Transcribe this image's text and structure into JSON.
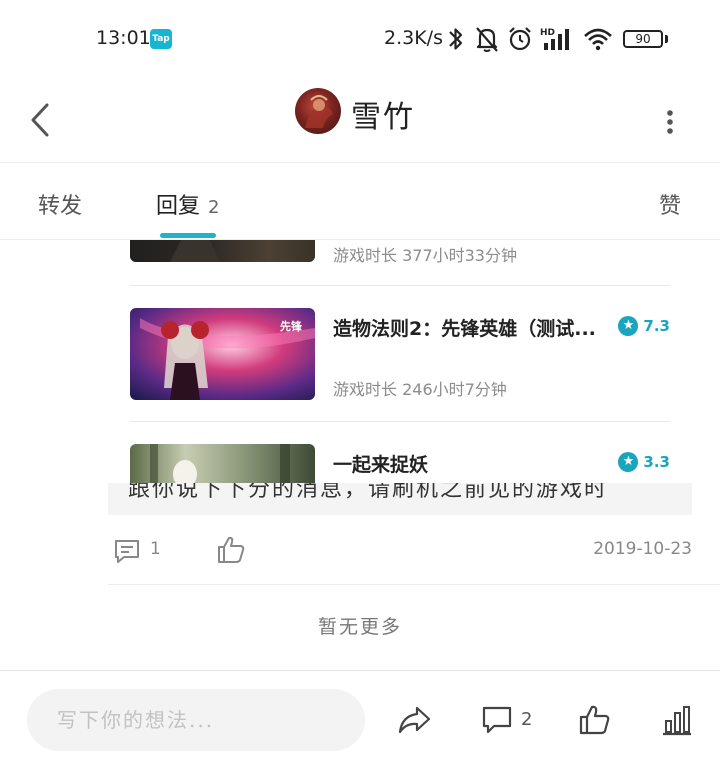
{
  "status_bar": {
    "time": "13:01",
    "tap_badge": "Tap",
    "net_speed": "2.3K/s",
    "battery": "90"
  },
  "header": {
    "title": "雪竹"
  },
  "tabs": {
    "repost": "转发",
    "replies": "回复",
    "replies_count": "2",
    "likes": "赞"
  },
  "games": [
    {
      "title": "",
      "score": "",
      "meta": "游戏时长 377小时33分钟"
    },
    {
      "title": "造物法则2：先锋英雄（测试...",
      "score": "7.3",
      "meta": "游戏时长 246小时7分钟"
    },
    {
      "title": "一起来捉妖",
      "score": "3.3",
      "meta": ""
    }
  ],
  "post": {
    "text_fragment": "跟你说下下分的消息，请刷机之前见的游戏时",
    "comment_count": "1",
    "date": "2019-10-23"
  },
  "no_more": "暂无更多",
  "bottom_bar": {
    "input_placeholder": "写下你的想法...",
    "comment_count": "2"
  },
  "colors": {
    "accent": "#1fb2c9",
    "score": "#1aa5bf"
  }
}
